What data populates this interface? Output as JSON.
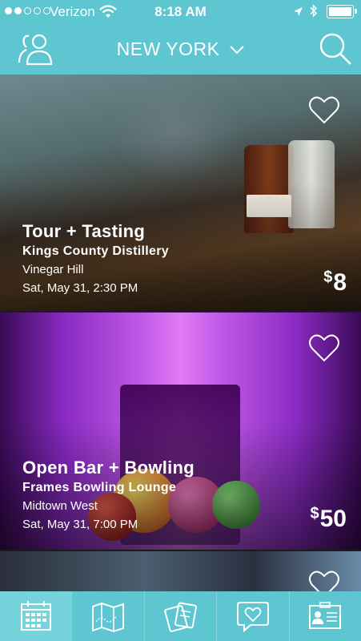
{
  "status_bar": {
    "carrier": "Verizon",
    "time": "8:18 AM",
    "signal_bars": 2,
    "signal_total": 5
  },
  "nav": {
    "city": "NEW YORK",
    "left_icon": "users-icon",
    "right_icon": "search-icon"
  },
  "events": [
    {
      "title": "Tour + Tasting",
      "venue": "Kings County Distillery",
      "neighborhood": "Vinegar Hill",
      "datetime": "Sat, May 31, 2:30 PM",
      "currency": "$",
      "price": "8"
    },
    {
      "title": "Open Bar + Bowling",
      "venue": "Frames Bowling Lounge",
      "neighborhood": "Midtown West",
      "datetime": "Sat, May 31, 7:00 PM",
      "currency": "$",
      "price": "50"
    }
  ],
  "tabs": [
    {
      "icon": "calendar-icon",
      "active": true
    },
    {
      "icon": "map-icon",
      "active": false
    },
    {
      "icon": "tickets-icon",
      "active": false
    },
    {
      "icon": "heart-chat-icon",
      "active": false
    },
    {
      "icon": "id-card-icon",
      "active": false
    }
  ],
  "colors": {
    "accent": "#5dc6d0",
    "active_tab": "#75d3dc"
  }
}
